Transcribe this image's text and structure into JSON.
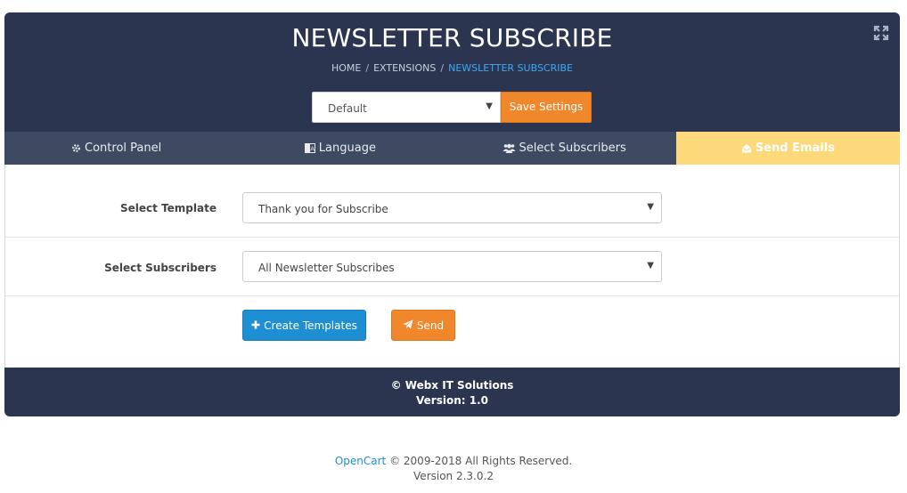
{
  "header": {
    "title": "NEWSLETTER SUBSCRIBE",
    "breadcrumb": [
      "HOME",
      "EXTENSIONS",
      "NEWSLETTER SUBSCRIBE"
    ],
    "store_select_value": "Default",
    "save_label": "Save Settings"
  },
  "tabs": [
    {
      "label": "Control Panel",
      "icon": "cog-icon",
      "active": false
    },
    {
      "label": "Language",
      "icon": "language-icon",
      "active": false
    },
    {
      "label": "Select Subscribers",
      "icon": "users-icon",
      "active": false
    },
    {
      "label": "Send Emails",
      "icon": "envelope-icon",
      "active": true
    }
  ],
  "form": {
    "template_label": "Select Template",
    "template_value": "Thank you for Subscribe",
    "subscribers_label": "Select Subscribers",
    "subscribers_value": "All Newsletter Subscribes",
    "create_label": "Create Templates",
    "send_label": "Send"
  },
  "panel_footer": {
    "copyright": "© Webx IT Solutions",
    "version": "Version: 1.0"
  },
  "page_footer": {
    "link": "OpenCart",
    "rights": "© 2009-2018 All Rights Reserved.",
    "version": "Version 2.3.0.2"
  },
  "colors": {
    "header_bg": "#2b3550",
    "tab_bar_bg": "#3d4a62",
    "active_tab_bg": "#fed97c",
    "orange": "#f0872b",
    "blue": "#1f8fd4",
    "breadcrumb_active": "#3fa9f5"
  }
}
